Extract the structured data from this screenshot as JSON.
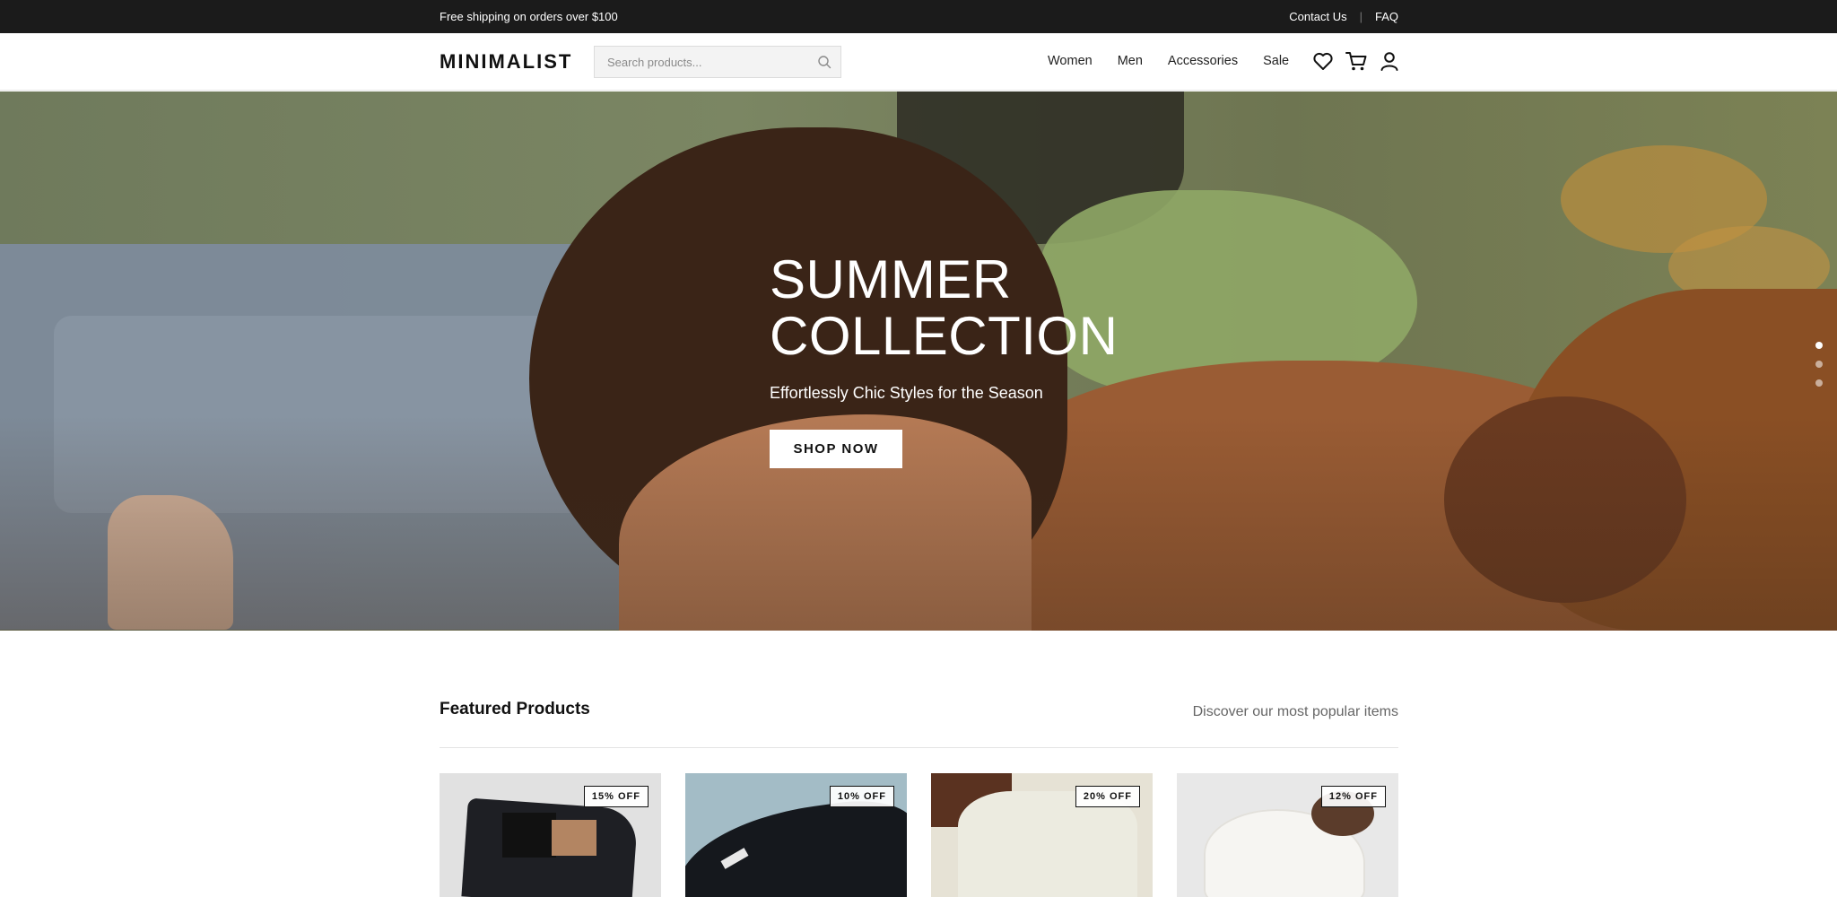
{
  "topbar": {
    "shipping_text": "Free shipping on orders over $100",
    "contact_label": "Contact Us",
    "separator": "|",
    "faq_label": "FAQ"
  },
  "header": {
    "logo": "MINIMALIST",
    "search": {
      "placeholder": "Search products...",
      "icon": "search-icon"
    },
    "nav": [
      "Women",
      "Men",
      "Accessories",
      "Sale"
    ],
    "icons": [
      "heart-icon",
      "cart-icon",
      "user-icon"
    ]
  },
  "hero": {
    "title": "SUMMER COLLECTION",
    "subtitle": "Effortlessly Chic Styles for the Season",
    "cta_label": "SHOP NOW",
    "slide_count": 3,
    "active_slide": 1
  },
  "featured": {
    "title": "Featured Products",
    "subtitle": "Discover our most popular items",
    "products": [
      {
        "badge": "15% OFF"
      },
      {
        "badge": "10% OFF"
      },
      {
        "badge": "20% OFF"
      },
      {
        "badge": "12% OFF"
      }
    ]
  },
  "colors": {
    "topbar_bg": "#1b1b1b",
    "text": "#111111",
    "hero_text": "#ffffff"
  }
}
